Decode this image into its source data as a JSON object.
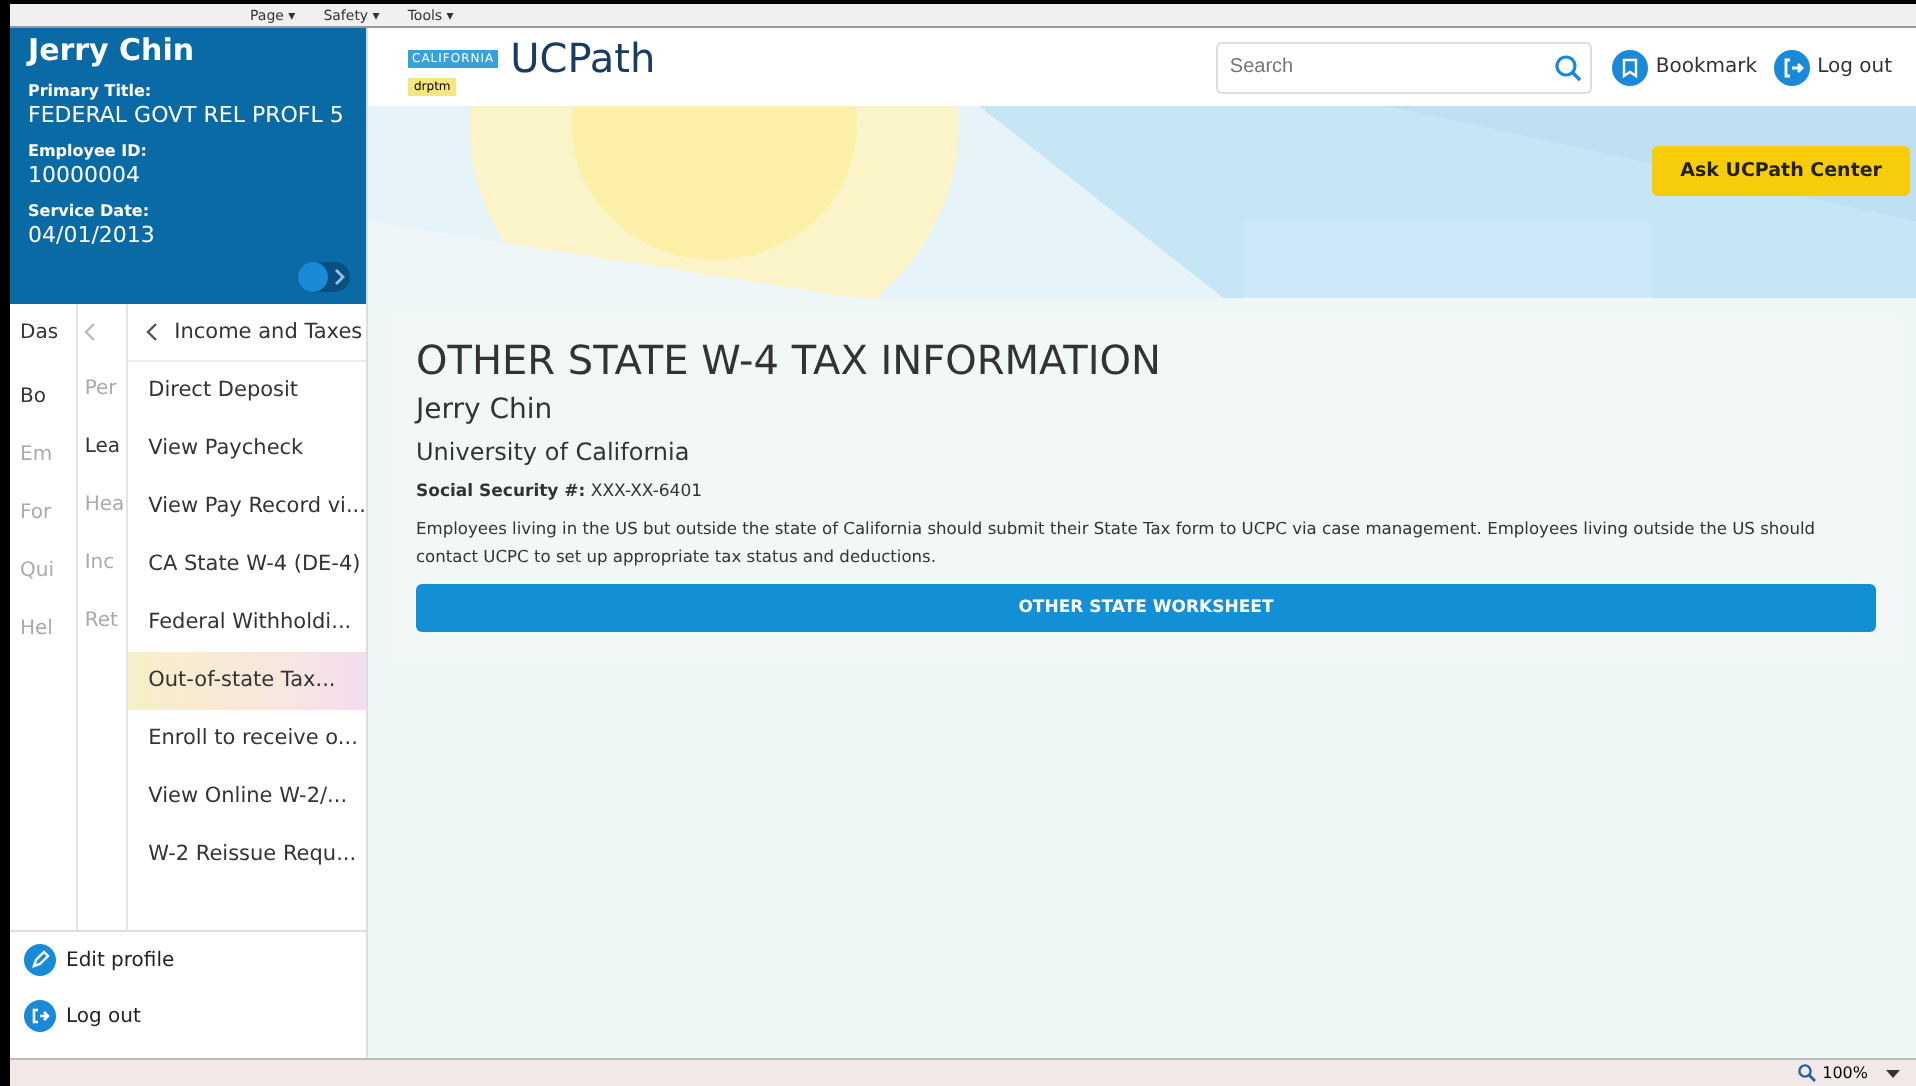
{
  "browser_toolbar": {
    "menus": [
      "Page ▾",
      "Safety ▾",
      "Tools ▾"
    ]
  },
  "profile": {
    "name": "Jerry Chin",
    "fields": [
      {
        "label": "Primary Title:",
        "value": "FEDERAL GOVT REL PROFL 5"
      },
      {
        "label": "Employee ID:",
        "value": "10000004"
      },
      {
        "label": "Service Date:",
        "value": "04/01/2013"
      }
    ],
    "toggle": {
      "on": false
    }
  },
  "menu_column_1": {
    "items": [
      {
        "label": "Das",
        "dimmed": false
      },
      {
        "label": "Bo",
        "dimmed": false
      },
      {
        "label": "Em",
        "dimmed": true
      },
      {
        "label": "For",
        "dimmed": true
      },
      {
        "label": "Qui",
        "dimmed": true
      },
      {
        "label": "Hel",
        "dimmed": true
      }
    ]
  },
  "menu_column_2": {
    "items": [
      {
        "label": "Per",
        "dimmed": true
      },
      {
        "label": "Lea",
        "dimmed": false
      },
      {
        "label": "Hea",
        "dimmed": true
      },
      {
        "label": "Inc",
        "dimmed": true
      },
      {
        "label": "Ret",
        "dimmed": true
      }
    ]
  },
  "menu_column_3": {
    "title": "Income and Taxes",
    "items": [
      {
        "label": "Direct Deposit",
        "selected": false
      },
      {
        "label": "View Paycheck",
        "selected": false
      },
      {
        "label": "View Pay Record vi...",
        "selected": false
      },
      {
        "label": "CA State W-4 (DE-4)",
        "selected": false
      },
      {
        "label": "Federal Withholdi...",
        "selected": false
      },
      {
        "label": "Out-of-state Tax...",
        "selected": true
      },
      {
        "label": "Enroll to receive o...",
        "selected": false
      },
      {
        "label": "View Online W-2/...",
        "selected": false
      },
      {
        "label": "W-2 Reissue Requ...",
        "selected": false
      }
    ]
  },
  "sidebar_footer": [
    {
      "label": "Edit profile",
      "kind": "edit"
    },
    {
      "label": "Log out",
      "kind": "logout"
    }
  ],
  "header": {
    "badge": "CALIFORNIA",
    "logo": "UCPath",
    "tag": "drptm",
    "search": {
      "placeholder": "Search"
    },
    "bookmark": "Bookmark",
    "logout": "Log out"
  },
  "banner": {
    "button": "Ask UCPath Center"
  },
  "card": {
    "title": "OTHER STATE W-4 TAX INFORMATION",
    "name": "Jerry Chin",
    "organization": "University of California",
    "ssn": "**Social Security #:** XXX-XX-6401",
    "note": "Employees living in the US but outside the state of California should submit their State Tax form to UCPC via case management. Employees living outside the US should contact UCPC to set up appropriate tax status and deductions.",
    "button": "OTHER STATE WORKSHEET"
  },
  "status_bar": {
    "zoom": "100%"
  }
}
